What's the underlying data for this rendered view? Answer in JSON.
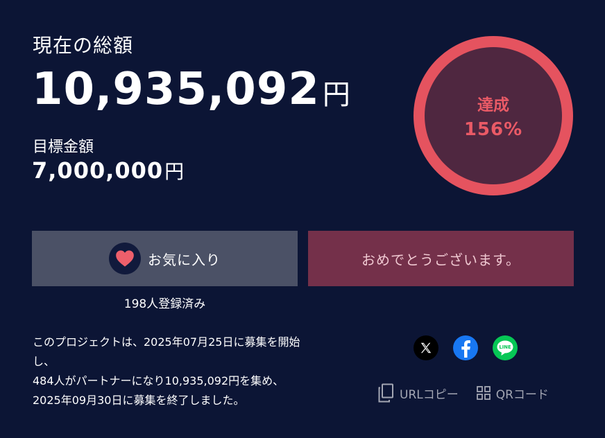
{
  "funding": {
    "current_label": "現在の総額",
    "current_amount": "10,935,092",
    "current_unit": "円",
    "goal_label": "目標金額",
    "goal_amount": "7,000,000",
    "goal_unit": "円"
  },
  "achievement": {
    "label": "達成",
    "percent_text": "156%",
    "percent_value": 156,
    "ring_color": "#e5535f",
    "inner_color": "#4f2740"
  },
  "actions": {
    "favorite_label": "お気に入り",
    "favorite_count": "198人登録済み",
    "congrats_label": "おめでとうございます。"
  },
  "summary": {
    "line1": "このプロジェクトは、2025年07月25日に募集を開始",
    "line2": "し、",
    "line3": "484人がパートナーになり10,935,092円を集め、",
    "line4": "2025年09月30日に募集を終了しました。"
  },
  "share": {
    "icons": [
      "x-icon",
      "facebook-icon",
      "line-icon"
    ],
    "line_text": "LINE",
    "url_copy_label": "URLコピー",
    "qr_code_label": "QRコード"
  },
  "colors": {
    "background": "#0c1535",
    "favorite_button": "#4b5166",
    "congrats_button": "#74304a",
    "heart": "#ee5f6b"
  }
}
